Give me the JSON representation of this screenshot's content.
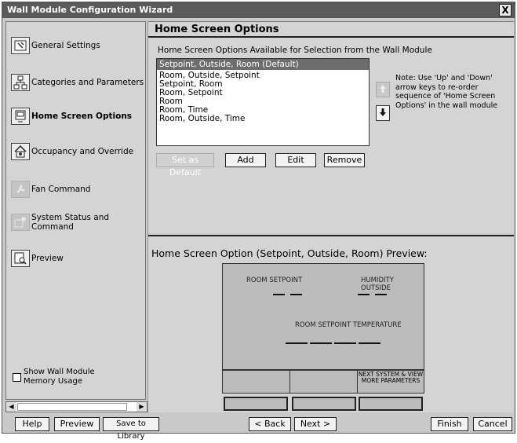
{
  "window": {
    "title": "Wall Module Configuration Wizard",
    "close_label": "X"
  },
  "sidebar": {
    "items": [
      {
        "label": "General Settings",
        "icon": "settings-icon"
      },
      {
        "label": "Categories and Parameters",
        "icon": "hierarchy-icon"
      },
      {
        "label": "Home Screen Options",
        "icon": "screen-icon",
        "active": true
      },
      {
        "label": "Occupancy and Override",
        "icon": "house-icon"
      },
      {
        "label": "Fan Command",
        "icon": "fan-icon",
        "disabled": true
      },
      {
        "label": "System Status and Command",
        "icon": "status-icon",
        "disabled": true
      },
      {
        "label": "Preview",
        "icon": "preview-icon"
      }
    ],
    "memory_checkbox": {
      "label": "Show Wall Module Memory Usage",
      "checked": false
    }
  },
  "main": {
    "header": "Home Screen Options",
    "list_caption": "Home Screen Options Available for Selection from the Wall Module",
    "options": [
      "Setpoint, Outside, Room (Default)",
      "Room, Outside, Setpoint",
      "Setpoint, Room",
      "Room, Setpoint",
      "Room",
      "Room, Time",
      "Room, Outside, Time"
    ],
    "selected_index": 0,
    "note": "Note: Use 'Up' and 'Down' arrow keys to re-order sequence of 'Home Screen Options' in  the wall module",
    "buttons": {
      "set_default": "Set as Default",
      "add": "Add",
      "edit": "Edit",
      "remove": "Remove"
    }
  },
  "preview": {
    "title": "Home Screen Option (Setpoint, Outside, Room) Preview:",
    "label_setpoint": "ROOM SETPOINT",
    "label_humidity": "HUMIDITY OUTSIDE",
    "label_temperature": "ROOM SETPOINT  TEMPERATURE",
    "next_system": "NEXT SYSTEM & VIEW MORE PARAMETERS"
  },
  "footer": {
    "help": "Help",
    "preview": "Preview",
    "save_library": "Save to Library",
    "back": "< Back",
    "next": "Next >",
    "finish": "Finish",
    "cancel": "Cancel"
  }
}
